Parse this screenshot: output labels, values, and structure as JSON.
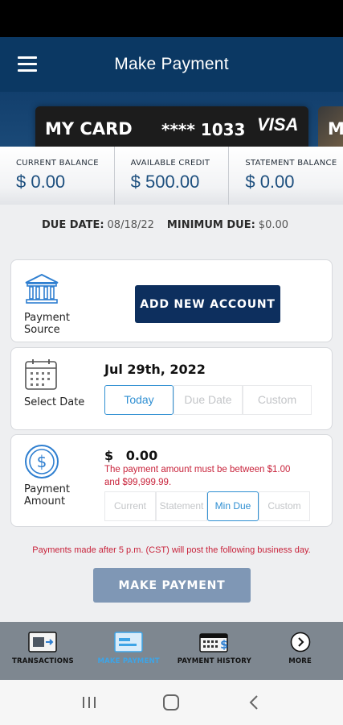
{
  "header": {
    "title": "Make Payment"
  },
  "card": {
    "name": "MY CARD",
    "number": "**** 1033",
    "brand": "VISA",
    "next_card_initial": "M"
  },
  "balances": [
    {
      "label": "CURRENT BALANCE",
      "value": "$ 0.00"
    },
    {
      "label": "AVAILABLE CREDIT",
      "value": "$ 500.00"
    },
    {
      "label": "STATEMENT BALANCE",
      "value": "$ 0.00"
    }
  ],
  "due": {
    "due_date_label": "DUE DATE:",
    "due_date": "08/18/22",
    "min_due_label": "MINIMUM DUE:",
    "min_due": "$0.00"
  },
  "payment_source": {
    "label_line1": "Payment",
    "label_line2": "Source",
    "add_account_label": "ADD NEW ACCOUNT"
  },
  "select_date": {
    "label": "Select Date",
    "date": "Jul 29th, 2022",
    "options": [
      "Today",
      "Due Date",
      "Custom"
    ],
    "selected": "Today"
  },
  "payment_amount": {
    "label_line1": "Payment",
    "label_line2": "Amount",
    "currency": "$",
    "value": "0.00",
    "error_line1": "The payment amount must be between $1.00",
    "error_line2": "and $99,999.99.",
    "options": [
      "Current",
      "Statement",
      "Min Due",
      "Custom"
    ],
    "selected": "Min Due"
  },
  "notice": "Payments made after 5 p.m. (CST) will post the following business day.",
  "make_payment_label": "MAKE PAYMENT",
  "tabs": [
    {
      "label": "TRANSACTIONS",
      "icon": "transactions-icon"
    },
    {
      "label": "MAKE PAYMENT",
      "icon": "card-payment-icon"
    },
    {
      "label": "PAYMENT HISTORY",
      "icon": "calendar-dollar-icon"
    },
    {
      "label": "MORE",
      "icon": "chevron-right-circle-icon"
    }
  ],
  "active_tab": "MAKE PAYMENT",
  "colors": {
    "header": "#0b3863",
    "primary_button": "#0d2f5e",
    "disabled_button": "#7f97b5",
    "accent": "#2f8fd2",
    "error": "#c8233b",
    "tab_bar": "#7e8790"
  }
}
